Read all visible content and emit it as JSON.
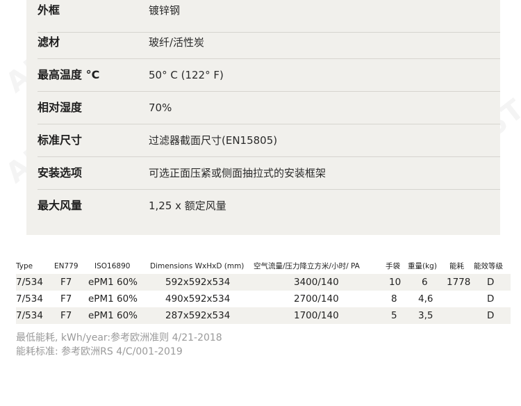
{
  "specs": [
    {
      "key": "外框",
      "value": "镀锌钢"
    },
    {
      "key": "滤材",
      "value": "玻纤/活性炭"
    },
    {
      "key": "最高温度 °C",
      "value": "50° C (122° F)"
    },
    {
      "key": "相对湿度",
      "value": "70%"
    },
    {
      "key": "标准尺寸",
      "value": "过滤器截面尺寸(EN15805)"
    },
    {
      "key": "安装选项",
      "value": "可选正面压紧或侧面抽拉式的安装框架"
    },
    {
      "key": "最大风量",
      "value": "1,25 x 额定风量"
    }
  ],
  "table": {
    "headers": [
      "Type",
      "EN779",
      "ISO16890",
      "Dimensions WxHxD (mm)",
      "空气流量/压力降立方米/小时/ PA",
      "手袋",
      "重量(kg)",
      "能耗",
      "能效等级"
    ],
    "rows": [
      [
        "7/534",
        "F7",
        "ePM1 60%",
        "592x592x534",
        "3400/140",
        "10",
        "6",
        "1778",
        "D"
      ],
      [
        "7/534",
        "F7",
        "ePM1 60%",
        "490x592x534",
        "2700/140",
        "8",
        "4,6",
        "",
        "D"
      ],
      [
        "7/534",
        "F7",
        "ePM1 60%",
        "287x592x534",
        "1700/140",
        "5",
        "3,5",
        "",
        "D"
      ]
    ]
  },
  "footnotes": [
    "最低能耗, kWh/year:参考欧洲准则 4/21-2018",
    "能耗标准: 参考欧洲RS 4/C/001-2019"
  ],
  "watermark_text": "AMST"
}
